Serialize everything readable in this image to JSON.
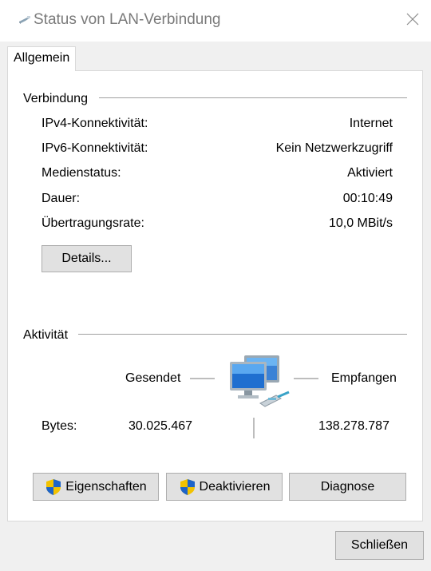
{
  "window": {
    "title": "Status von LAN-Verbindung"
  },
  "tabs": [
    {
      "label": "Allgemein"
    }
  ],
  "connection": {
    "group_title": "Verbindung",
    "rows": [
      {
        "label": "IPv4-Konnektivität:",
        "value": "Internet"
      },
      {
        "label": "IPv6-Konnektivität:",
        "value": "Kein Netzwerkzugriff"
      },
      {
        "label": "Medienstatus:",
        "value": "Aktiviert"
      },
      {
        "label": "Dauer:",
        "value": "00:10:49"
      },
      {
        "label": "Übertragungsrate:",
        "value": "10,0 MBit/s"
      }
    ],
    "details_button": "Details..."
  },
  "activity": {
    "group_title": "Aktivität",
    "sent_label": "Gesendet",
    "received_label": "Empfangen",
    "bytes_label": "Bytes:",
    "bytes_sent": "30.025.467",
    "bytes_received": "138.278.787"
  },
  "buttons": {
    "properties": "Eigenschaften",
    "deactivate": "Deaktivieren",
    "diagnose": "Diagnose",
    "close": "Schließen"
  },
  "icons": {
    "title": "network-connection-icon",
    "close": "close-icon",
    "shield": "uac-shield-icon",
    "activity": "network-computers-icon"
  }
}
